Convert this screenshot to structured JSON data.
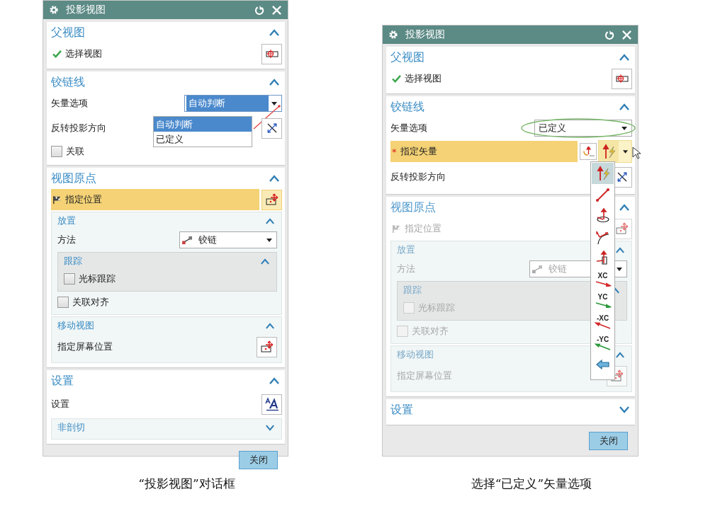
{
  "figures": [
    {
      "dialog": {
        "title": "投影视图",
        "close_button": "关闭",
        "sections": [
          {
            "title": "父视图",
            "expanded": true,
            "disabled": false,
            "rows": [
              {
                "kind": "view",
                "label": "选择视图",
                "active": false
              }
            ]
          },
          {
            "title": "铰链线",
            "expanded": true,
            "disabled": false,
            "rows": [
              {
                "kind": "dropdown",
                "label": "矢量选项",
                "value": "自动判断",
                "focused": true,
                "open": true,
                "linked": true,
                "options": [
                  {
                    "label": "自动判断",
                    "selected": true
                  },
                  {
                    "label": "已定义",
                    "selected": false
                  }
                ]
              },
              {
                "kind": "flip",
                "label": "反转投影方向"
              },
              {
                "kind": "checkbox",
                "label": "关联",
                "checked": false
              }
            ]
          },
          {
            "title": "视图原点",
            "expanded": true,
            "disabled": false,
            "rows": [
              {
                "kind": "point",
                "label": "指定位置",
                "active": true
              },
              {
                "kind": "group",
                "title": "放置",
                "expanded": true,
                "rows": [
                  {
                    "kind": "method",
                    "label": "方法",
                    "value": "铰链",
                    "focused": false
                  },
                  {
                    "kind": "subgroup",
                    "title": "跟踪",
                    "expanded": true,
                    "rows": [
                      {
                        "kind": "checkbox",
                        "label": "光标跟踪",
                        "checked": false
                      }
                    ]
                  },
                  {
                    "kind": "checkbox",
                    "label": "关联对齐",
                    "checked": false
                  }
                ]
              },
              {
                "kind": "group",
                "title": "移动视图",
                "expanded": true,
                "rows": [
                  {
                    "kind": "move",
                    "label": "指定屏幕位置"
                  }
                ]
              }
            ]
          },
          {
            "title": "设置",
            "expanded": true,
            "disabled": false,
            "rows": [
              {
                "kind": "style",
                "label": "设置"
              },
              {
                "kind": "group",
                "title": "非剖切",
                "expanded": false
              }
            ]
          }
        ]
      },
      "caption": "“投影视图”对话框"
    },
    {
      "dialog": {
        "title": "投影视图",
        "close_button": "关闭",
        "sections": [
          {
            "title": "父视图",
            "expanded": true,
            "disabled": false,
            "rows": [
              {
                "kind": "view",
                "label": "选择视图",
                "active": false
              }
            ]
          },
          {
            "title": "铰链线",
            "expanded": true,
            "disabled": false,
            "rows": [
              {
                "kind": "dropdown",
                "label": "矢量选项",
                "value": "已定义",
                "focused": false,
                "circled": true
              },
              {
                "kind": "vector",
                "label": "指定矢量",
                "required_mark": "*",
                "active": true,
                "open": true,
                "options": [
                  {
                    "kind": "inferred",
                    "selected": true
                  },
                  {
                    "kind": "two-points",
                    "selected": false
                  },
                  {
                    "kind": "plane-normal",
                    "selected": false
                  },
                  {
                    "kind": "curve-tangent",
                    "selected": false
                  },
                  {
                    "kind": "face-normal",
                    "selected": false
                  },
                  {
                    "kind": "axis",
                    "label": "XC",
                    "color": "#d42a2a",
                    "selected": false
                  },
                  {
                    "kind": "axis",
                    "label": "YC",
                    "color": "#2a9a3a",
                    "selected": false
                  },
                  {
                    "kind": "axis",
                    "label": "-XC",
                    "color": "#d42a2a",
                    "selected": false
                  },
                  {
                    "kind": "axis",
                    "label": "-YC",
                    "color": "#2a9a3a",
                    "selected": false
                  },
                  {
                    "kind": "view",
                    "selected": false
                  }
                ]
              },
              {
                "kind": "flip",
                "label": "反转投影方向"
              }
            ]
          },
          {
            "title": "视图原点",
            "expanded": true,
            "disabled": true,
            "rows": [
              {
                "kind": "point",
                "label": "指定位置",
                "active": false
              },
              {
                "kind": "group",
                "title": "放置",
                "expanded": true,
                "rows": [
                  {
                    "kind": "method",
                    "label": "方法",
                    "value": "铰链",
                    "focused": false
                  },
                  {
                    "kind": "subgroup",
                    "title": "跟踪",
                    "expanded": true,
                    "rows": [
                      {
                        "kind": "checkbox",
                        "label": "光标跟踪",
                        "checked": false
                      }
                    ]
                  },
                  {
                    "kind": "checkbox",
                    "label": "关联对齐",
                    "checked": false
                  }
                ]
              },
              {
                "kind": "group",
                "title": "移动视图",
                "expanded": true,
                "rows": [
                  {
                    "kind": "move",
                    "label": "指定屏幕位置"
                  }
                ]
              }
            ]
          },
          {
            "title": "设置",
            "expanded": false,
            "disabled": false
          }
        ]
      },
      "caption": "选择“已定义”矢量选项"
    }
  ]
}
